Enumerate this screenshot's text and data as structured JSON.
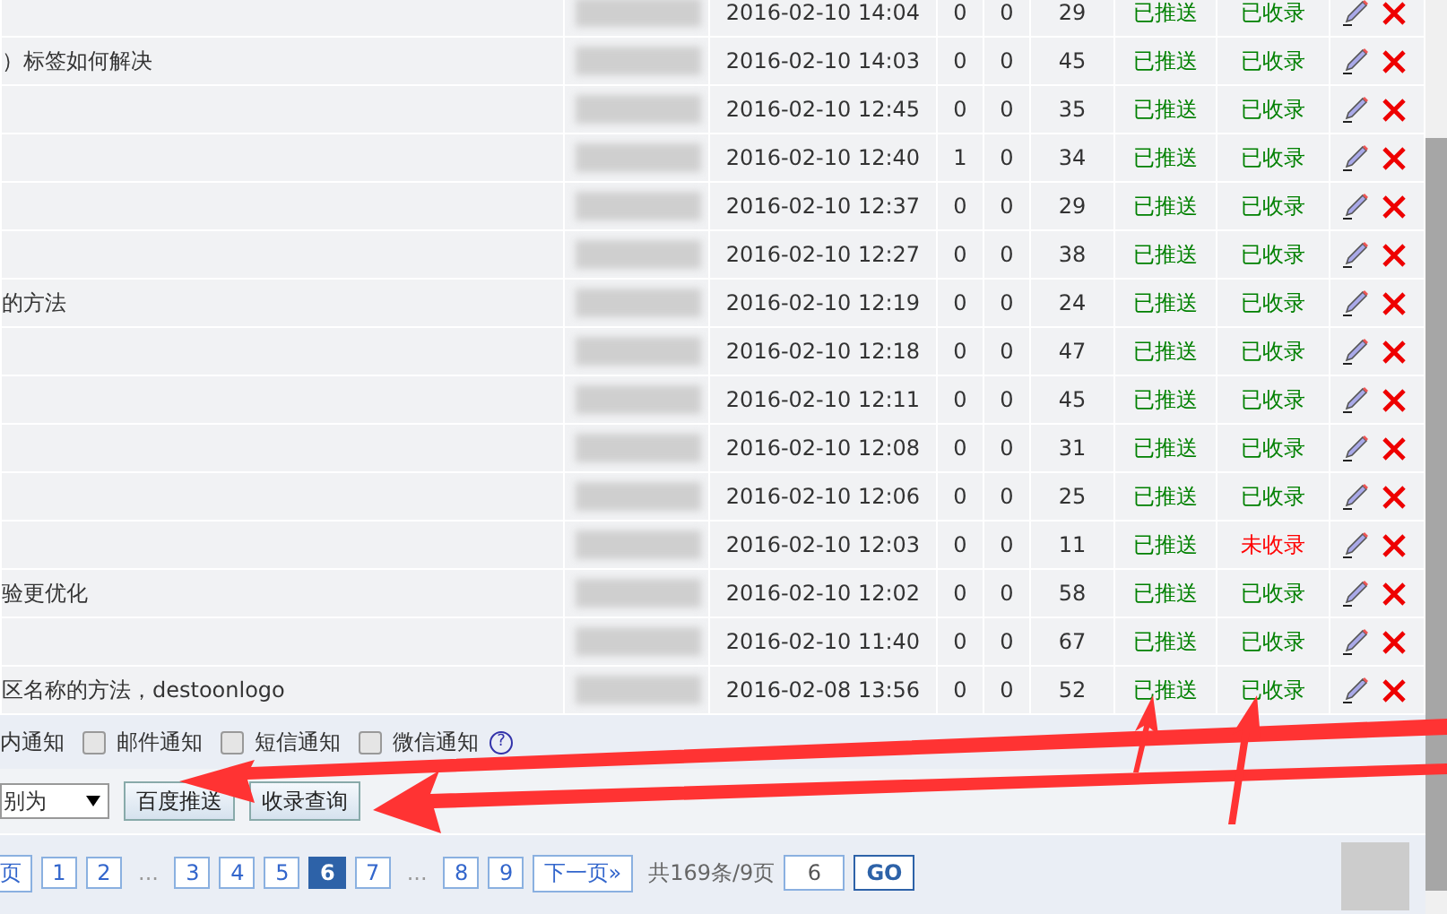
{
  "table": {
    "rows": [
      {
        "title": "",
        "date": "2016-02-10 14:04",
        "col_a": "0",
        "col_b": "0",
        "col_c": "29",
        "push": {
          "text": "已推送",
          "ok": true
        },
        "index": {
          "text": "已收录",
          "ok": true
        }
      },
      {
        "title": "）标签如何解决",
        "date": "2016-02-10 14:03",
        "col_a": "0",
        "col_b": "0",
        "col_c": "45",
        "push": {
          "text": "已推送",
          "ok": true
        },
        "index": {
          "text": "已收录",
          "ok": true
        }
      },
      {
        "title": "",
        "date": "2016-02-10 12:45",
        "col_a": "0",
        "col_b": "0",
        "col_c": "35",
        "push": {
          "text": "已推送",
          "ok": true
        },
        "index": {
          "text": "已收录",
          "ok": true
        }
      },
      {
        "title": "",
        "date": "2016-02-10 12:40",
        "col_a": "1",
        "col_b": "0",
        "col_c": "34",
        "push": {
          "text": "已推送",
          "ok": true
        },
        "index": {
          "text": "已收录",
          "ok": true
        }
      },
      {
        "title": "",
        "date": "2016-02-10 12:37",
        "col_a": "0",
        "col_b": "0",
        "col_c": "29",
        "push": {
          "text": "已推送",
          "ok": true
        },
        "index": {
          "text": "已收录",
          "ok": true
        }
      },
      {
        "title": "",
        "date": "2016-02-10 12:27",
        "col_a": "0",
        "col_b": "0",
        "col_c": "38",
        "push": {
          "text": "已推送",
          "ok": true
        },
        "index": {
          "text": "已收录",
          "ok": true
        }
      },
      {
        "title": "的方法",
        "date": "2016-02-10 12:19",
        "col_a": "0",
        "col_b": "0",
        "col_c": "24",
        "push": {
          "text": "已推送",
          "ok": true
        },
        "index": {
          "text": "已收录",
          "ok": true
        }
      },
      {
        "title": "",
        "date": "2016-02-10 12:18",
        "col_a": "0",
        "col_b": "0",
        "col_c": "47",
        "push": {
          "text": "已推送",
          "ok": true
        },
        "index": {
          "text": "已收录",
          "ok": true
        }
      },
      {
        "title": "",
        "date": "2016-02-10 12:11",
        "col_a": "0",
        "col_b": "0",
        "col_c": "45",
        "push": {
          "text": "已推送",
          "ok": true
        },
        "index": {
          "text": "已收录",
          "ok": true
        }
      },
      {
        "title": "",
        "date": "2016-02-10 12:08",
        "col_a": "0",
        "col_b": "0",
        "col_c": "31",
        "push": {
          "text": "已推送",
          "ok": true
        },
        "index": {
          "text": "已收录",
          "ok": true
        }
      },
      {
        "title": "",
        "date": "2016-02-10 12:06",
        "col_a": "0",
        "col_b": "0",
        "col_c": "25",
        "push": {
          "text": "已推送",
          "ok": true
        },
        "index": {
          "text": "已收录",
          "ok": true
        }
      },
      {
        "title": "",
        "date": "2016-02-10 12:03",
        "col_a": "0",
        "col_b": "0",
        "col_c": "11",
        "push": {
          "text": "已推送",
          "ok": true
        },
        "index": {
          "text": "未收录",
          "ok": false
        }
      },
      {
        "title": "验更优化",
        "date": "2016-02-10 12:02",
        "col_a": "0",
        "col_b": "0",
        "col_c": "58",
        "push": {
          "text": "已推送",
          "ok": true
        },
        "index": {
          "text": "已收录",
          "ok": true
        }
      },
      {
        "title": "",
        "date": "2016-02-10 11:40",
        "col_a": "0",
        "col_b": "0",
        "col_c": "67",
        "push": {
          "text": "已推送",
          "ok": true
        },
        "index": {
          "text": "已收录",
          "ok": true
        }
      },
      {
        "title": "区名称的方法，destoonlogo",
        "date": "2016-02-08 13:56",
        "col_a": "0",
        "col_b": "0",
        "col_c": "52",
        "push": {
          "text": "已推送",
          "ok": true
        },
        "index": {
          "text": "已收录",
          "ok": true
        }
      }
    ]
  },
  "notify": {
    "lead": "内通知",
    "options": [
      {
        "label": "邮件通知",
        "checked": false
      },
      {
        "label": "短信通知",
        "checked": false
      },
      {
        "label": "微信通知",
        "checked": false
      }
    ],
    "help": "?"
  },
  "actions": {
    "select": {
      "value": "别为"
    },
    "buttons": [
      "百度推送",
      "收录查询"
    ]
  },
  "pagination": {
    "prev": "页",
    "pages": [
      {
        "label": "1",
        "selected": false
      },
      {
        "label": "2",
        "selected": false
      },
      {
        "label": "...",
        "kind": "gap"
      },
      {
        "label": "3",
        "selected": false
      },
      {
        "label": "4",
        "selected": false
      },
      {
        "label": "5",
        "selected": false
      },
      {
        "label": "6",
        "selected": true
      },
      {
        "label": "7",
        "selected": false
      },
      {
        "label": "...",
        "kind": "gap"
      },
      {
        "label": "8",
        "selected": false
      },
      {
        "label": "9",
        "selected": false
      }
    ],
    "next": "下一页»",
    "total": "共169条/9页",
    "jump": "6",
    "go": "GO"
  }
}
